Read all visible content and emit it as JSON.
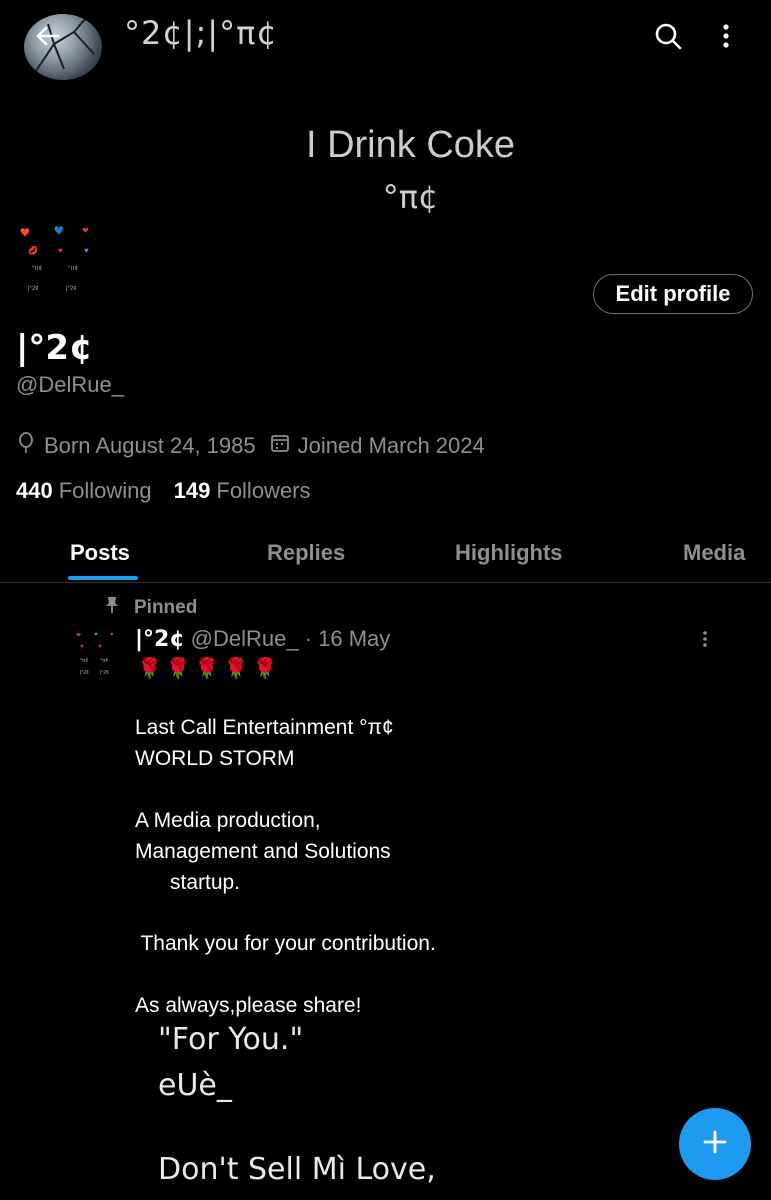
{
  "header": {
    "title": "°2¢|;|°π¢"
  },
  "banner": {
    "line1": "I Drink Coke",
    "line2": "°π¢"
  },
  "profile": {
    "edit_label": "Edit profile",
    "display_name": "|°2¢",
    "handle": "@DelRue_",
    "born": "Born August 24, 1985",
    "joined": "Joined March 2024",
    "following_count": "440",
    "following_label": "Following",
    "followers_count": "149",
    "followers_label": "Followers"
  },
  "tabs": [
    {
      "label": "Posts",
      "active": true
    },
    {
      "label": "Replies",
      "active": false
    },
    {
      "label": "Highlights",
      "active": false
    },
    {
      "label": "Media",
      "active": false
    }
  ],
  "post": {
    "pinned_label": "Pinned",
    "author_name": "|°2¢",
    "author_meta": "@DelRue_ · 16 May",
    "roses": "🌹🌹🌹🌹🌹",
    "lines": [
      "Last Call Entertainment °π¢",
      "WORLD STORM",
      "A Media production,",
      "Management and Solutions",
      "      startup.",
      " Thank you for your contribution.",
      "As always,please share!"
    ],
    "embed_lines": [
      "\"For You.\"",
      "eUè_",
      "Don't Sell Mì Love,"
    ]
  },
  "colors": {
    "accent": "#1d9bf0",
    "background": "#000000",
    "muted": "#8b9096"
  }
}
